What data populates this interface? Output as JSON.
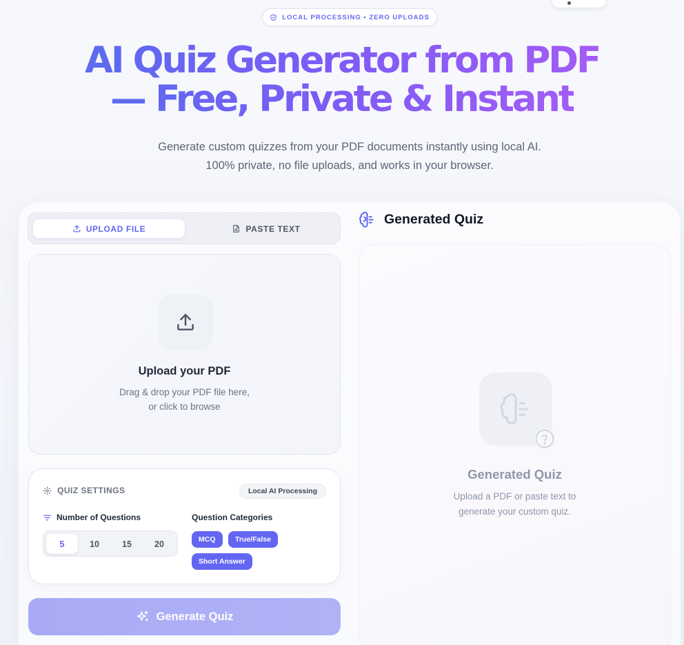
{
  "badge": {
    "text": "LOCAL PROCESSING • ZERO UPLOADS",
    "icon": "shield-check-icon"
  },
  "hero": {
    "title_line1": "AI Quiz Generator from PDF",
    "title_line2": "— Free, Private & Instant",
    "subtitle": "Generate custom quizzes from your PDF documents instantly using local AI. 100% private, no file uploads, and works in your browser."
  },
  "tabs": [
    {
      "label": "UPLOAD FILE",
      "icon": "upload-icon",
      "active": true
    },
    {
      "label": "PASTE TEXT",
      "icon": "document-icon",
      "active": false
    }
  ],
  "dropzone": {
    "title": "Upload your PDF",
    "line1": "Drag & drop your PDF file here,",
    "line2": "or click to browse"
  },
  "settings": {
    "heading": "QUIZ SETTINGS",
    "badge": "Local AI Processing",
    "questions_label": "Number of Questions",
    "categories_label": "Question Categories",
    "counts": [
      "5",
      "10",
      "15",
      "20"
    ],
    "selected_count": "5",
    "categories": [
      "MCQ",
      "True/False",
      "Short Answer"
    ]
  },
  "generate": {
    "label": "Generate Quiz"
  },
  "result": {
    "heading": "Generated Quiz",
    "empty_title": "Generated Quiz",
    "empty_line1": "Upload a PDF or paste text to",
    "empty_line2": "generate your custom quiz."
  },
  "colors": {
    "accent": "#6366f1",
    "accent_light": "#a9aaf5",
    "title_gradient_start": "#5b6cf0",
    "title_gradient_end": "#a35cf6"
  }
}
